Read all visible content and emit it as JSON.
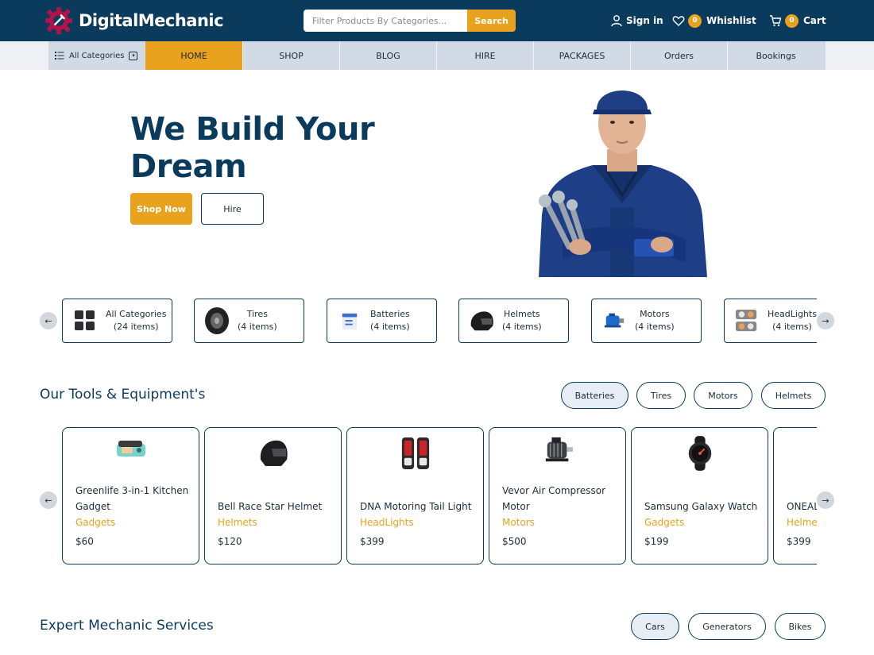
{
  "header": {
    "brand": "DigitalMechanic",
    "search_placeholder": "Filter Products By Categories...",
    "search_button": "Search",
    "signin": "Sign in",
    "wishlist_label": "Whishlist",
    "wishlist_count": "0",
    "cart_label": "Cart",
    "cart_count": "0"
  },
  "nav": {
    "all_categories": "All Categories",
    "items": [
      "HOME",
      "SHOP",
      "BLOG",
      "HIRE",
      "PACKAGES",
      "Orders",
      "Bookings"
    ],
    "active": "HOME"
  },
  "hero": {
    "title": "We Build Your Dream",
    "shop_button": "Shop Now",
    "hire_button": "Hire"
  },
  "categories": [
    {
      "name": "All Categories",
      "count": "(24 items)",
      "icon": "grid-icon"
    },
    {
      "name": "Tires",
      "count": "(4 items)",
      "icon": "tire-icon"
    },
    {
      "name": "Batteries",
      "count": "(4 items)",
      "icon": "battery-icon"
    },
    {
      "name": "Helmets",
      "count": "(4 items)",
      "icon": "helmet-icon"
    },
    {
      "name": "Motors",
      "count": "(4 items)",
      "icon": "motor-icon"
    },
    {
      "name": "HeadLights",
      "count": "(4 items)",
      "icon": "headlight-icon"
    }
  ],
  "tools": {
    "title": "Our Tools & Equipment's",
    "filters": [
      "Batteries",
      "Tires",
      "Motors",
      "Helmets"
    ],
    "active_filter": "Batteries",
    "products": [
      {
        "name": "Greenlife 3-in-1 Kitchen Gadget",
        "category": "Gadgets",
        "price": "$60",
        "icon": "kitchen-gadget-icon"
      },
      {
        "name": "Bell Race Star Helmet",
        "category": "Helmets",
        "price": "$120",
        "icon": "helmet-icon"
      },
      {
        "name": "DNA Motoring Tail Light",
        "category": "HeadLights",
        "price": "$399",
        "icon": "tail-light-icon"
      },
      {
        "name": "Vevor Air Compressor Motor",
        "category": "Motors",
        "price": "$500",
        "icon": "motor-icon"
      },
      {
        "name": "Samsung Galaxy Watch",
        "category": "Gadgets",
        "price": "$199",
        "icon": "watch-icon"
      },
      {
        "name": "ONEAL Helmet",
        "category": "Helmets",
        "price": "$399",
        "icon": "helmet-icon"
      }
    ]
  },
  "services": {
    "title": "Expert Mechanic Services",
    "filters": [
      "Cars",
      "Generators",
      "Bikes"
    ],
    "active_filter": "Cars"
  },
  "colors": {
    "primary": "#0a3a5c",
    "accent": "#e9a21d",
    "nav_bg": "#d2dbe5"
  }
}
